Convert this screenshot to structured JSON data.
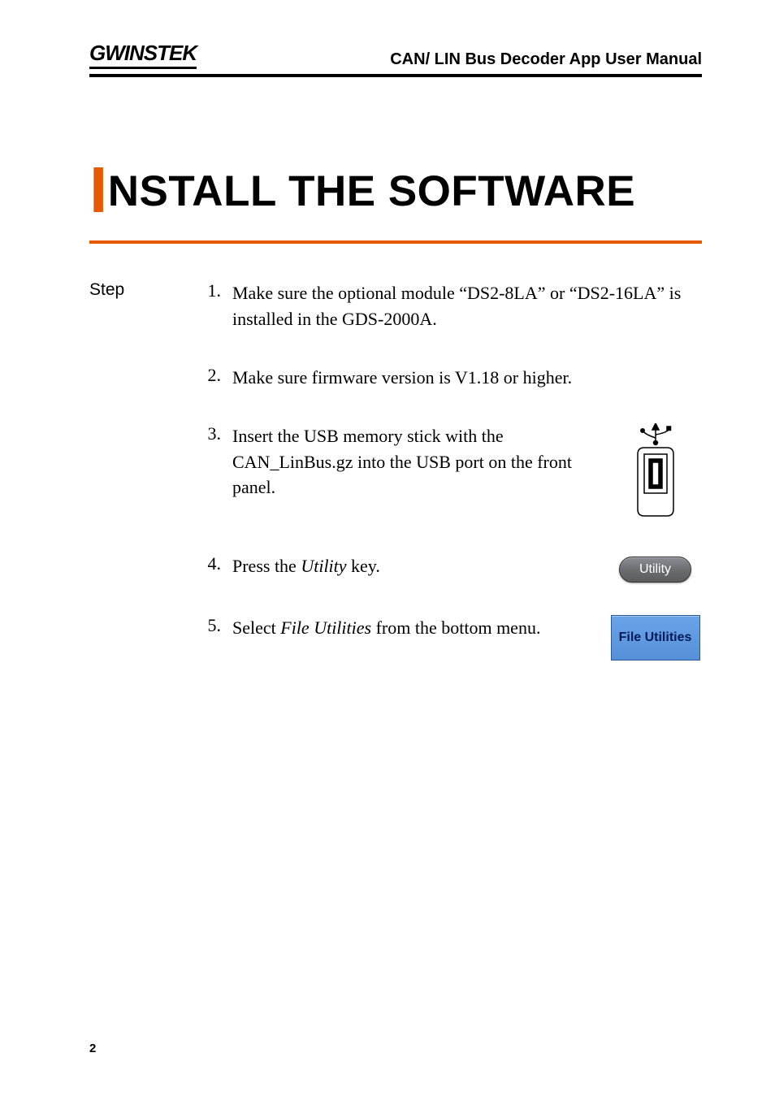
{
  "header": {
    "logo": "GWINSTEK",
    "title": "CAN/ LIN Bus Decoder App User Manual"
  },
  "main_title_initial": "I",
  "main_title_rest": "NSTALL THE SOFTWARE",
  "step_label": "Step",
  "steps": [
    {
      "num": "1.",
      "text": "Make sure the optional module “DS2-8LA” or “DS2-16LA” is installed in the GDS-2000A."
    },
    {
      "num": "2.",
      "text": "Make sure firmware version is V1.18 or higher."
    },
    {
      "num": "3.",
      "text": "Insert the USB memory stick with the CAN_LinBus.gz into the USB port on the front panel."
    },
    {
      "num": "4.",
      "text_before": "Press the ",
      "text_italic": "Utility",
      "text_after": " key."
    },
    {
      "num": "5.",
      "text_before": "Select ",
      "text_italic": "File Utilities",
      "text_after": " from the bottom menu."
    }
  ],
  "buttons": {
    "utility": "Utility",
    "file_utilities": "File Utilities"
  },
  "page_number": "2"
}
